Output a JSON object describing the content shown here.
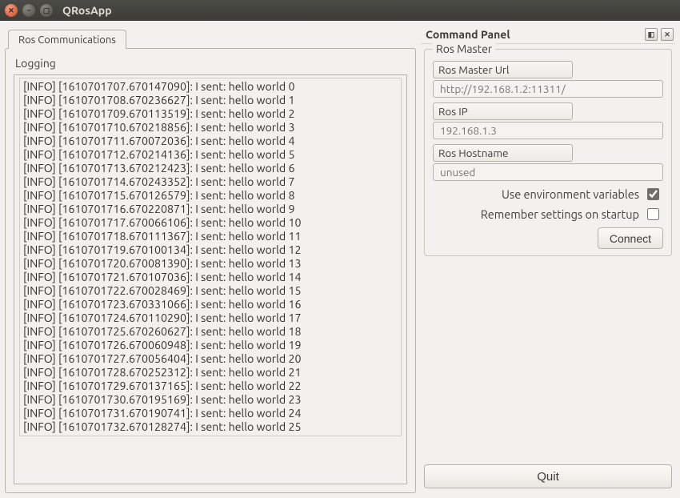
{
  "window": {
    "title": "QRosApp"
  },
  "tabs": {
    "ros_comm": "Ros Communications"
  },
  "logging": {
    "label": "Logging",
    "lines": [
      "[INFO] [1610701707.670147090]: I sent: hello world 0",
      "[INFO] [1610701708.670236627]: I sent: hello world 1",
      "[INFO] [1610701709.670113519]: I sent: hello world 2",
      "[INFO] [1610701710.670218856]: I sent: hello world 3",
      "[INFO] [1610701711.670072036]: I sent: hello world 4",
      "[INFO] [1610701712.670214136]: I sent: hello world 5",
      "[INFO] [1610701713.670212423]: I sent: hello world 6",
      "[INFO] [1610701714.670243352]: I sent: hello world 7",
      "[INFO] [1610701715.670126579]: I sent: hello world 8",
      "[INFO] [1610701716.670220871]: I sent: hello world 9",
      "[INFO] [1610701717.670066106]: I sent: hello world 10",
      "[INFO] [1610701718.670111367]: I sent: hello world 11",
      "[INFO] [1610701719.670100134]: I sent: hello world 12",
      "[INFO] [1610701720.670081390]: I sent: hello world 13",
      "[INFO] [1610701721.670107036]: I sent: hello world 14",
      "[INFO] [1610701722.670028469]: I sent: hello world 15",
      "[INFO] [1610701723.670331066]: I sent: hello world 16",
      "[INFO] [1610701724.670110290]: I sent: hello world 17",
      "[INFO] [1610701725.670260627]: I sent: hello world 18",
      "[INFO] [1610701726.670060948]: I sent: hello world 19",
      "[INFO] [1610701727.670056404]: I sent: hello world 20",
      "[INFO] [1610701728.670252312]: I sent: hello world 21",
      "[INFO] [1610701729.670137165]: I sent: hello world 22",
      "[INFO] [1610701730.670195169]: I sent: hello world 23",
      "[INFO] [1610701731.670190741]: I sent: hello world 24",
      "[INFO] [1610701732.670128274]: I sent: hello world 25"
    ]
  },
  "dock": {
    "title": "Command Panel",
    "groupbox_title": "Ros Master",
    "master_url_label": "Ros Master Url",
    "master_url_placeholder": "http://192.168.1.2:11311/",
    "ros_ip_label": "Ros IP",
    "ros_ip_placeholder": "192.168.1.3",
    "ros_hostname_label": "Ros Hostname",
    "ros_hostname_placeholder": "unused",
    "use_env_label": "Use environment variables",
    "remember_label": "Remember settings on startup",
    "connect_label": "Connect",
    "quit_label": "Quit"
  }
}
